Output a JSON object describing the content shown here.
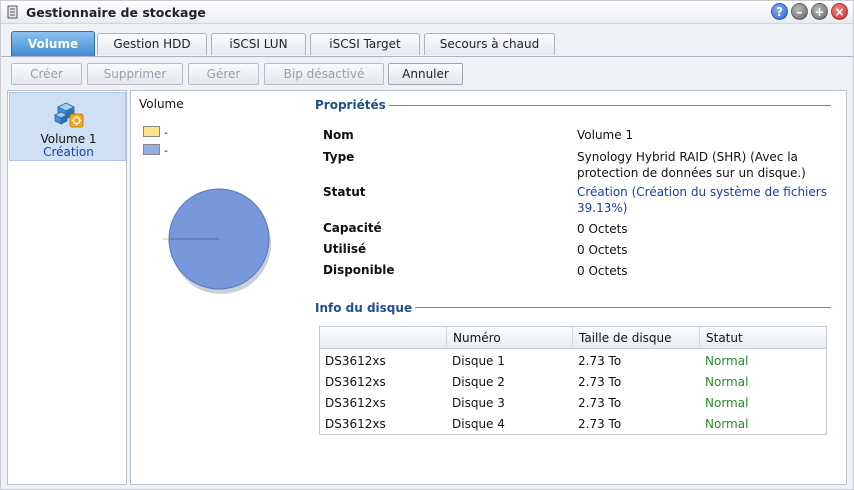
{
  "window": {
    "title": "Gestionnaire de stockage"
  },
  "tabs": [
    {
      "label": "Volume"
    },
    {
      "label": "Gestion HDD"
    },
    {
      "label": "iSCSI LUN"
    },
    {
      "label": "iSCSI Target"
    },
    {
      "label": "Secours à chaud"
    }
  ],
  "toolbar": {
    "create": "Créer",
    "delete": "Supprimer",
    "manage": "Gérer",
    "bip": "Bip désactivé",
    "cancel": "Annuler"
  },
  "sidebar": {
    "volume_name": "Volume 1",
    "volume_status": "Création"
  },
  "chart": {
    "title": "Volume",
    "legend": [
      {
        "label": "-",
        "color": "#ffe48a"
      },
      {
        "label": "-",
        "color": "#95aee0"
      }
    ],
    "pie_color": "#7898dc"
  },
  "properties": {
    "title": "Propriétés",
    "name_label": "Nom",
    "name_value": "Volume 1",
    "type_label": "Type",
    "type_value": "Synology Hybrid RAID (SHR) (Avec la protection de données sur un disque.)",
    "status_label": "Statut",
    "status_value": "Création (Création du système de fichiers 39.13%)",
    "capacity_label": "Capacité",
    "capacity_value": "0 Octets",
    "used_label": "Utilisé",
    "used_value": "0 Octets",
    "available_label": "Disponible",
    "available_value": "0 Octets"
  },
  "disk_info": {
    "title": "Info du disque",
    "columns": [
      "",
      "Numéro",
      "Taille de disque",
      "Statut"
    ],
    "rows": [
      {
        "model": "DS3612xs",
        "number": "Disque 1",
        "size": "2.73 To",
        "status": "Normal"
      },
      {
        "model": "DS3612xs",
        "number": "Disque 2",
        "size": "2.73 To",
        "status": "Normal"
      },
      {
        "model": "DS3612xs",
        "number": "Disque 3",
        "size": "2.73 To",
        "status": "Normal"
      },
      {
        "model": "DS3612xs",
        "number": "Disque 4",
        "size": "2.73 To",
        "status": "Normal"
      }
    ]
  }
}
